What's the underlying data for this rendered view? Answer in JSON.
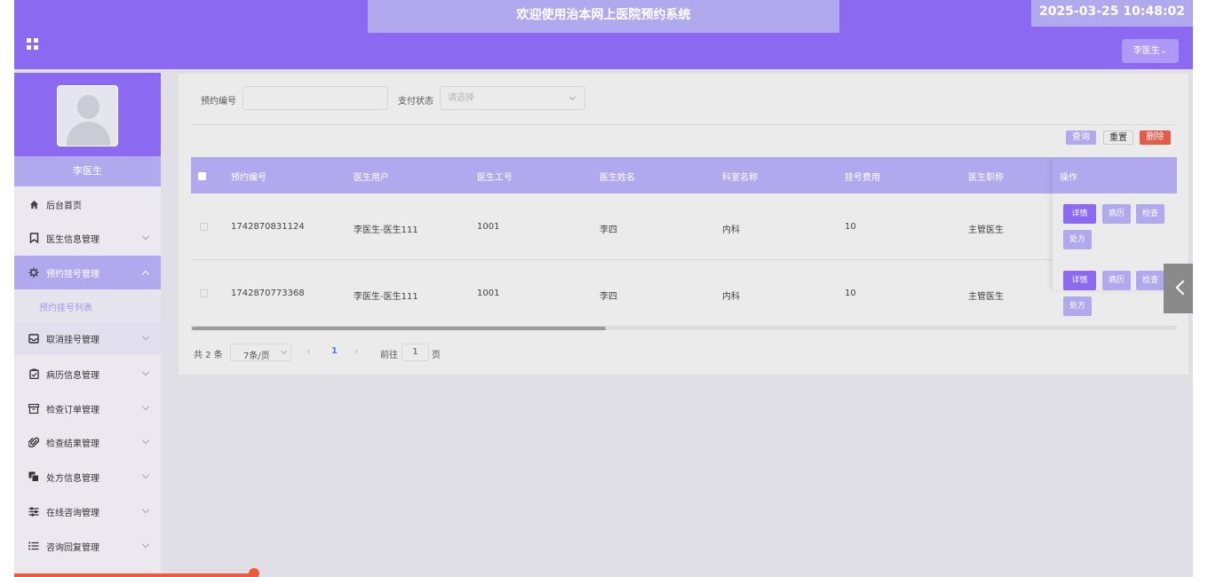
{
  "header": {
    "title": "欢迎使用治本网上医院预约系统",
    "clock": "2025-03-25 10:48:02",
    "user_menu": "李医生⌄"
  },
  "sidebar": {
    "profile_name": "李医生",
    "items": [
      {
        "label": "后台首页",
        "icon": "home-icon"
      },
      {
        "label": "医生信息管理",
        "icon": "bookmark-icon"
      },
      {
        "label": "预约挂号管理",
        "icon": "gear-icon",
        "active": true
      },
      {
        "label": "取消挂号管理",
        "icon": "inbox-icon"
      },
      {
        "label": "病历信息管理",
        "icon": "clipboard-icon"
      },
      {
        "label": "检查订单管理",
        "icon": "archive-icon"
      },
      {
        "label": "检查结果管理",
        "icon": "paperclip-icon"
      },
      {
        "label": "处方信息管理",
        "icon": "copy-icon"
      },
      {
        "label": "在线咨询管理",
        "icon": "sliders-icon"
      },
      {
        "label": "咨询回复管理",
        "icon": "list-icon"
      }
    ],
    "submenu_label": "预约挂号列表"
  },
  "search": {
    "booking_no_label": "预约编号",
    "booking_no_value": "",
    "pay_status_label": "支付状态",
    "pay_status_placeholder": "请选择"
  },
  "actions": {
    "query": "查询",
    "reset": "重置",
    "delete": "删除"
  },
  "table": {
    "columns": [
      "预约编号",
      "医生用户",
      "医生工号",
      "医生姓名",
      "科室名称",
      "挂号费用",
      "医生职称"
    ],
    "ops_header": "操作",
    "rows": [
      {
        "booking_no": "1742870831124",
        "doctor_user": "李医生-医生111",
        "doctor_id": "1001",
        "doctor_name": "李四",
        "dept": "内科",
        "fee": "10",
        "title": "主管医生"
      },
      {
        "booking_no": "1742870773368",
        "doctor_user": "李医生-医生111",
        "doctor_id": "1001",
        "doctor_name": "李四",
        "dept": "内科",
        "fee": "10",
        "title": "主管医生"
      }
    ],
    "row_ops": {
      "detail": "详情",
      "record": "病历",
      "check": "检查",
      "prescription": "处方"
    }
  },
  "pagination": {
    "total": "共 2 条",
    "page_size": "7条/页",
    "prev": "‹",
    "current": "1",
    "next": "›",
    "goto_label": "前往",
    "goto_value": "1",
    "goto_suffix": "页"
  },
  "colors": {
    "primary": "#8b69f0",
    "light": "#b1a9ee",
    "danger": "#e65a4a"
  }
}
